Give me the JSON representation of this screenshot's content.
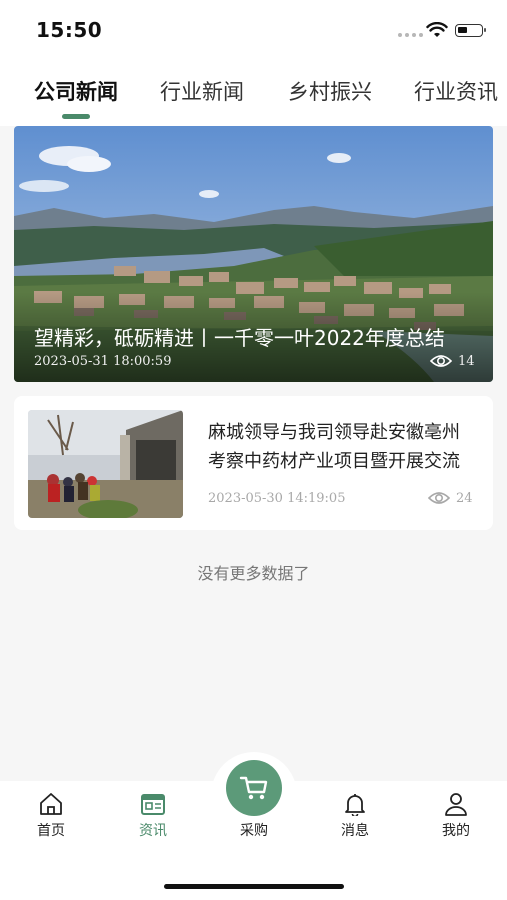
{
  "status_bar": {
    "time": "15:50"
  },
  "tabs": [
    {
      "label": "公司新闻",
      "active": true
    },
    {
      "label": "行业新闻",
      "active": false
    },
    {
      "label": "乡村振兴",
      "active": false
    },
    {
      "label": "行业资讯",
      "active": false
    }
  ],
  "hero": {
    "title": "望精彩，砥砺精进丨一千零一叶2022年度总结",
    "date": "2023-05-31 18:00:59",
    "views": "14"
  },
  "news": [
    {
      "title": "麻城领导与我司领导赴安徽亳州考察中药材产业项目暨开展交流活动",
      "date": "2023-05-30 14:19:05",
      "views": "24"
    }
  ],
  "no_more": "没有更多数据了",
  "tabbar": {
    "home": "首页",
    "news": "资讯",
    "purchase": "采购",
    "messages": "消息",
    "mine": "我的",
    "accent": "#4a8a6a"
  }
}
